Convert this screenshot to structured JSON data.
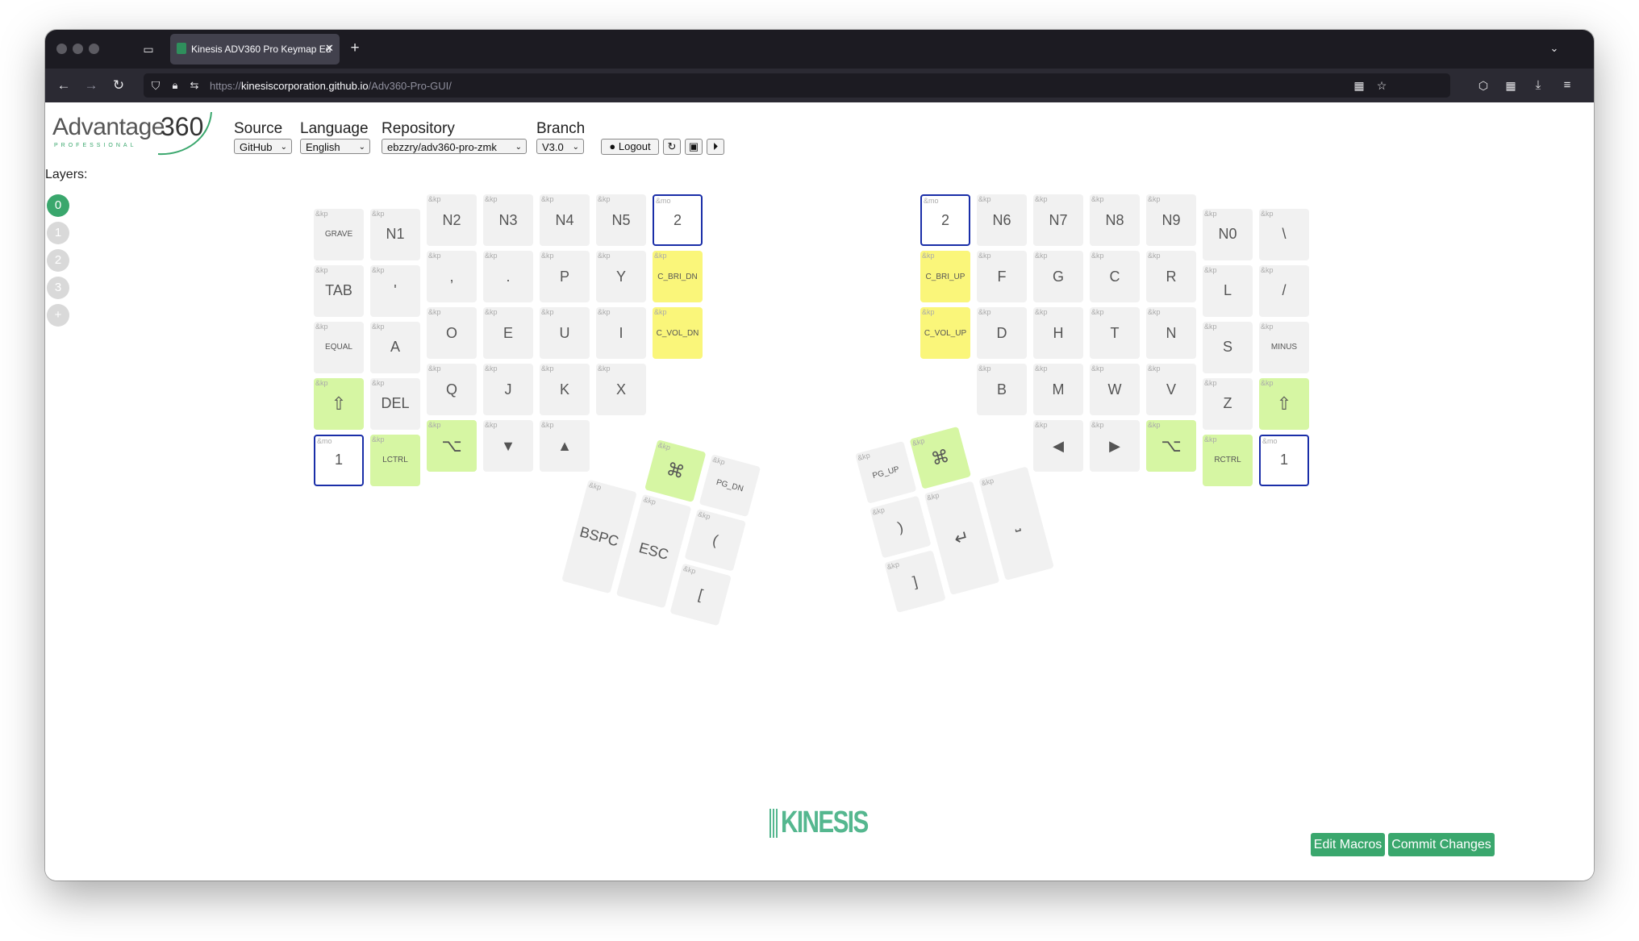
{
  "browser": {
    "tab_title": "Kinesis ADV360 Pro Keymap Ed",
    "new_tab_symbol": "+",
    "url_prefix": "https://",
    "url_host": "kinesiscorporation.github.io",
    "url_path": "/Adv360-Pro-GUI/"
  },
  "header": {
    "logo_text": "Advantage",
    "logo_number": "360",
    "logo_sub": "PROFESSIONAL",
    "source_label": "Source",
    "source_value": "GitHub",
    "language_label": "Language",
    "language_value": "English",
    "repository_label": "Repository",
    "repository_value": "ebzzry/adv360-pro-zmk",
    "branch_label": "Branch",
    "branch_value": "V3.0",
    "logout_label": "Logout"
  },
  "layers": {
    "title": "Layers:",
    "items": [
      "0",
      "1",
      "2",
      "3",
      "+"
    ],
    "active": "0"
  },
  "left_keys": [
    {
      "b": "&kp",
      "l": "GRAVE",
      "s": "sm",
      "c": "",
      "col": 0,
      "row": 0.25
    },
    {
      "b": "&kp",
      "l": "N1",
      "s": "",
      "c": "",
      "col": 1,
      "row": 0.25
    },
    {
      "b": "&kp",
      "l": "N2",
      "s": "",
      "c": "",
      "col": 2,
      "row": 0
    },
    {
      "b": "&kp",
      "l": "N3",
      "s": "",
      "c": "",
      "col": 3,
      "row": 0
    },
    {
      "b": "&kp",
      "l": "N4",
      "s": "",
      "c": "",
      "col": 4,
      "row": 0
    },
    {
      "b": "&kp",
      "l": "N5",
      "s": "",
      "c": "",
      "col": 5,
      "row": 0
    },
    {
      "b": "&mo",
      "l": "2",
      "s": "",
      "c": "outline",
      "col": 6,
      "row": 0
    },
    {
      "b": "&kp",
      "l": "TAB",
      "s": "",
      "c": "",
      "col": 0,
      "row": 1.25
    },
    {
      "b": "&kp",
      "l": "'",
      "s": "",
      "c": "",
      "col": 1,
      "row": 1.25
    },
    {
      "b": "&kp",
      "l": ",",
      "s": "",
      "c": "",
      "col": 2,
      "row": 1
    },
    {
      "b": "&kp",
      "l": ".",
      "s": "",
      "c": "",
      "col": 3,
      "row": 1
    },
    {
      "b": "&kp",
      "l": "P",
      "s": "",
      "c": "",
      "col": 4,
      "row": 1
    },
    {
      "b": "&kp",
      "l": "Y",
      "s": "",
      "c": "",
      "col": 5,
      "row": 1
    },
    {
      "b": "&kp",
      "l": "C_BRI_DN",
      "s": "sm",
      "c": "yellow",
      "col": 6,
      "row": 1
    },
    {
      "b": "&kp",
      "l": "EQUAL",
      "s": "sm",
      "c": "",
      "col": 0,
      "row": 2.25
    },
    {
      "b": "&kp",
      "l": "A",
      "s": "",
      "c": "",
      "col": 1,
      "row": 2.25
    },
    {
      "b": "&kp",
      "l": "O",
      "s": "",
      "c": "",
      "col": 2,
      "row": 2
    },
    {
      "b": "&kp",
      "l": "E",
      "s": "",
      "c": "",
      "col": 3,
      "row": 2
    },
    {
      "b": "&kp",
      "l": "U",
      "s": "",
      "c": "",
      "col": 4,
      "row": 2
    },
    {
      "b": "&kp",
      "l": "I",
      "s": "",
      "c": "",
      "col": 5,
      "row": 2
    },
    {
      "b": "&kp",
      "l": "C_VOL_DN",
      "s": "sm",
      "c": "yellow",
      "col": 6,
      "row": 2
    },
    {
      "b": "&kp",
      "l": "⇧",
      "s": "icon",
      "c": "green",
      "col": 0,
      "row": 3.25
    },
    {
      "b": "&kp",
      "l": "DEL",
      "s": "",
      "c": "",
      "col": 1,
      "row": 3.25
    },
    {
      "b": "&kp",
      "l": "Q",
      "s": "",
      "c": "",
      "col": 2,
      "row": 3
    },
    {
      "b": "&kp",
      "l": "J",
      "s": "",
      "c": "",
      "col": 3,
      "row": 3
    },
    {
      "b": "&kp",
      "l": "K",
      "s": "",
      "c": "",
      "col": 4,
      "row": 3
    },
    {
      "b": "&kp",
      "l": "X",
      "s": "",
      "c": "",
      "col": 5,
      "row": 3
    },
    {
      "b": "&mo",
      "l": "1",
      "s": "",
      "c": "outline",
      "col": 0,
      "row": 4.25
    },
    {
      "b": "&kp",
      "l": "LCTRL",
      "s": "sm",
      "c": "green",
      "col": 1,
      "row": 4.25
    },
    {
      "b": "&kp",
      "l": "⌥",
      "s": "icon",
      "c": "green",
      "col": 2,
      "row": 4
    },
    {
      "b": "&kp",
      "l": "▼",
      "s": "",
      "c": "",
      "col": 3,
      "row": 4
    },
    {
      "b": "&kp",
      "l": "▲",
      "s": "",
      "c": "",
      "col": 4,
      "row": 4
    }
  ],
  "right_keys": [
    {
      "b": "&mo",
      "l": "2",
      "s": "",
      "c": "outline",
      "col": 0,
      "row": 0
    },
    {
      "b": "&kp",
      "l": "N6",
      "s": "",
      "c": "",
      "col": 1,
      "row": 0
    },
    {
      "b": "&kp",
      "l": "N7",
      "s": "",
      "c": "",
      "col": 2,
      "row": 0
    },
    {
      "b": "&kp",
      "l": "N8",
      "s": "",
      "c": "",
      "col": 3,
      "row": 0
    },
    {
      "b": "&kp",
      "l": "N9",
      "s": "",
      "c": "",
      "col": 4,
      "row": 0
    },
    {
      "b": "&kp",
      "l": "N0",
      "s": "",
      "c": "",
      "col": 5,
      "row": 0.25
    },
    {
      "b": "&kp",
      "l": "\\",
      "s": "",
      "c": "",
      "col": 6,
      "row": 0.25
    },
    {
      "b": "&kp",
      "l": "C_BRI_UP",
      "s": "sm",
      "c": "yellow",
      "col": 0,
      "row": 1
    },
    {
      "b": "&kp",
      "l": "F",
      "s": "",
      "c": "",
      "col": 1,
      "row": 1
    },
    {
      "b": "&kp",
      "l": "G",
      "s": "",
      "c": "",
      "col": 2,
      "row": 1
    },
    {
      "b": "&kp",
      "l": "C",
      "s": "",
      "c": "",
      "col": 3,
      "row": 1
    },
    {
      "b": "&kp",
      "l": "R",
      "s": "",
      "c": "",
      "col": 4,
      "row": 1
    },
    {
      "b": "&kp",
      "l": "L",
      "s": "",
      "c": "",
      "col": 5,
      "row": 1.25
    },
    {
      "b": "&kp",
      "l": "/",
      "s": "",
      "c": "",
      "col": 6,
      "row": 1.25
    },
    {
      "b": "&kp",
      "l": "C_VOL_UP",
      "s": "sm",
      "c": "yellow",
      "col": 0,
      "row": 2
    },
    {
      "b": "&kp",
      "l": "D",
      "s": "",
      "c": "",
      "col": 1,
      "row": 2
    },
    {
      "b": "&kp",
      "l": "H",
      "s": "",
      "c": "",
      "col": 2,
      "row": 2
    },
    {
      "b": "&kp",
      "l": "T",
      "s": "",
      "c": "",
      "col": 3,
      "row": 2
    },
    {
      "b": "&kp",
      "l": "N",
      "s": "",
      "c": "",
      "col": 4,
      "row": 2
    },
    {
      "b": "&kp",
      "l": "S",
      "s": "",
      "c": "",
      "col": 5,
      "row": 2.25
    },
    {
      "b": "&kp",
      "l": "MINUS",
      "s": "sm",
      "c": "",
      "col": 6,
      "row": 2.25
    },
    {
      "b": "&kp",
      "l": "B",
      "s": "",
      "c": "",
      "col": 1,
      "row": 3
    },
    {
      "b": "&kp",
      "l": "M",
      "s": "",
      "c": "",
      "col": 2,
      "row": 3
    },
    {
      "b": "&kp",
      "l": "W",
      "s": "",
      "c": "",
      "col": 3,
      "row": 3
    },
    {
      "b": "&kp",
      "l": "V",
      "s": "",
      "c": "",
      "col": 4,
      "row": 3
    },
    {
      "b": "&kp",
      "l": "Z",
      "s": "",
      "c": "",
      "col": 5,
      "row": 3.25
    },
    {
      "b": "&kp",
      "l": "⇧",
      "s": "icon",
      "c": "green",
      "col": 6,
      "row": 3.25
    },
    {
      "b": "&kp",
      "l": "◀",
      "s": "",
      "c": "",
      "col": 2,
      "row": 4
    },
    {
      "b": "&kp",
      "l": "▶",
      "s": "",
      "c": "",
      "col": 3,
      "row": 4
    },
    {
      "b": "&kp",
      "l": "⌥",
      "s": "icon",
      "c": "green",
      "col": 4,
      "row": 4
    },
    {
      "b": "&kp",
      "l": "RCTRL",
      "s": "sm",
      "c": "green",
      "col": 5,
      "row": 4.25
    },
    {
      "b": "&mo",
      "l": "1",
      "s": "",
      "c": "outline",
      "col": 6,
      "row": 4.25
    }
  ],
  "left_thumb": [
    {
      "b": "&kp",
      "l": "⌘",
      "s": "icon",
      "c": "green",
      "col": 1,
      "row": 0,
      "tall": false
    },
    {
      "b": "&kp",
      "l": "PG_DN",
      "s": "sm",
      "c": "",
      "col": 2,
      "row": 0,
      "tall": false
    },
    {
      "b": "&kp",
      "l": "BSPC",
      "s": "",
      "c": "",
      "col": 0,
      "row": 1,
      "tall": true
    },
    {
      "b": "&kp",
      "l": "ESC",
      "s": "",
      "c": "",
      "col": 1,
      "row": 1,
      "tall": true
    },
    {
      "b": "&kp",
      "l": "(",
      "s": "",
      "c": "",
      "col": 2,
      "row": 1,
      "tall": false
    },
    {
      "b": "&kp",
      "l": "[",
      "s": "",
      "c": "",
      "col": 2,
      "row": 2,
      "tall": false
    }
  ],
  "right_thumb": [
    {
      "b": "&kp",
      "l": "PG_UP",
      "s": "sm",
      "c": "",
      "col": 0,
      "row": 0,
      "tall": false
    },
    {
      "b": "&kp",
      "l": "⌘",
      "s": "icon",
      "c": "green",
      "col": 1,
      "row": 0,
      "tall": false
    },
    {
      "b": "&kp",
      "l": ")",
      "s": "",
      "c": "",
      "col": 0,
      "row": 1,
      "tall": false
    },
    {
      "b": "&kp",
      "l": "↵",
      "s": "icon",
      "c": "",
      "col": 1,
      "row": 1,
      "tall": true
    },
    {
      "b": "&kp",
      "l": "⎵",
      "s": "",
      "c": "",
      "col": 2,
      "row": 1,
      "tall": true
    },
    {
      "b": "&kp",
      "l": "]",
      "s": "",
      "c": "",
      "col": 0,
      "row": 2,
      "tall": false
    }
  ],
  "footer": {
    "brand": "KINESIS",
    "edit_macros_label": "Edit Macros",
    "commit_label": "Commit Changes"
  },
  "colors": {
    "accent": "#3aa76d",
    "mod_key": "#d6f6a3",
    "media_key": "#faf67a",
    "layer_key_border": "#1a2ea8"
  }
}
